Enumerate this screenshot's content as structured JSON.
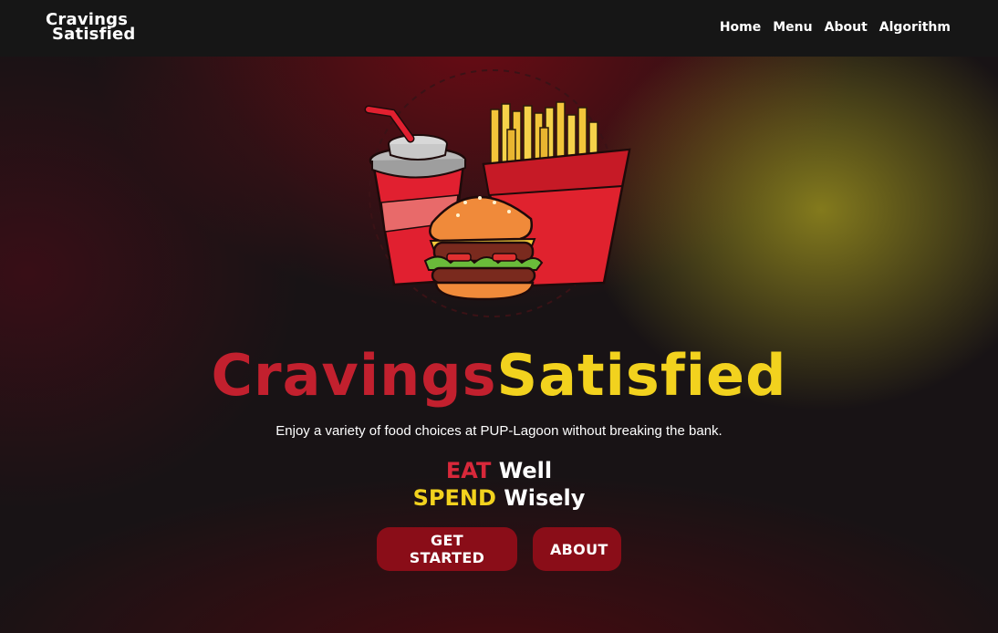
{
  "navbar": {
    "brand_line1": "Cravings",
    "brand_line2": "Satisfied",
    "links": [
      "Home",
      "Menu",
      "About",
      "Algorithm"
    ]
  },
  "hero": {
    "title_part1": "Cravings",
    "title_part2": "Satisfied",
    "tagline": "Enjoy a variety of food choices at PUP-Lagoon without breaking the bank.",
    "motto_line1_accent": "EAT",
    "motto_line1_rest": "Well",
    "motto_line2_accent": "SPEND",
    "motto_line2_rest": "Wisely",
    "image_icon": "fast-food-illustration",
    "buttons": {
      "get_started": "GET STARTED",
      "about": "ABOUT"
    }
  },
  "colors": {
    "accent_red": "#c2202e",
    "accent_yellow": "#f2d21e",
    "button_bg": "#8a0d18",
    "navbar_bg": "#161616"
  }
}
